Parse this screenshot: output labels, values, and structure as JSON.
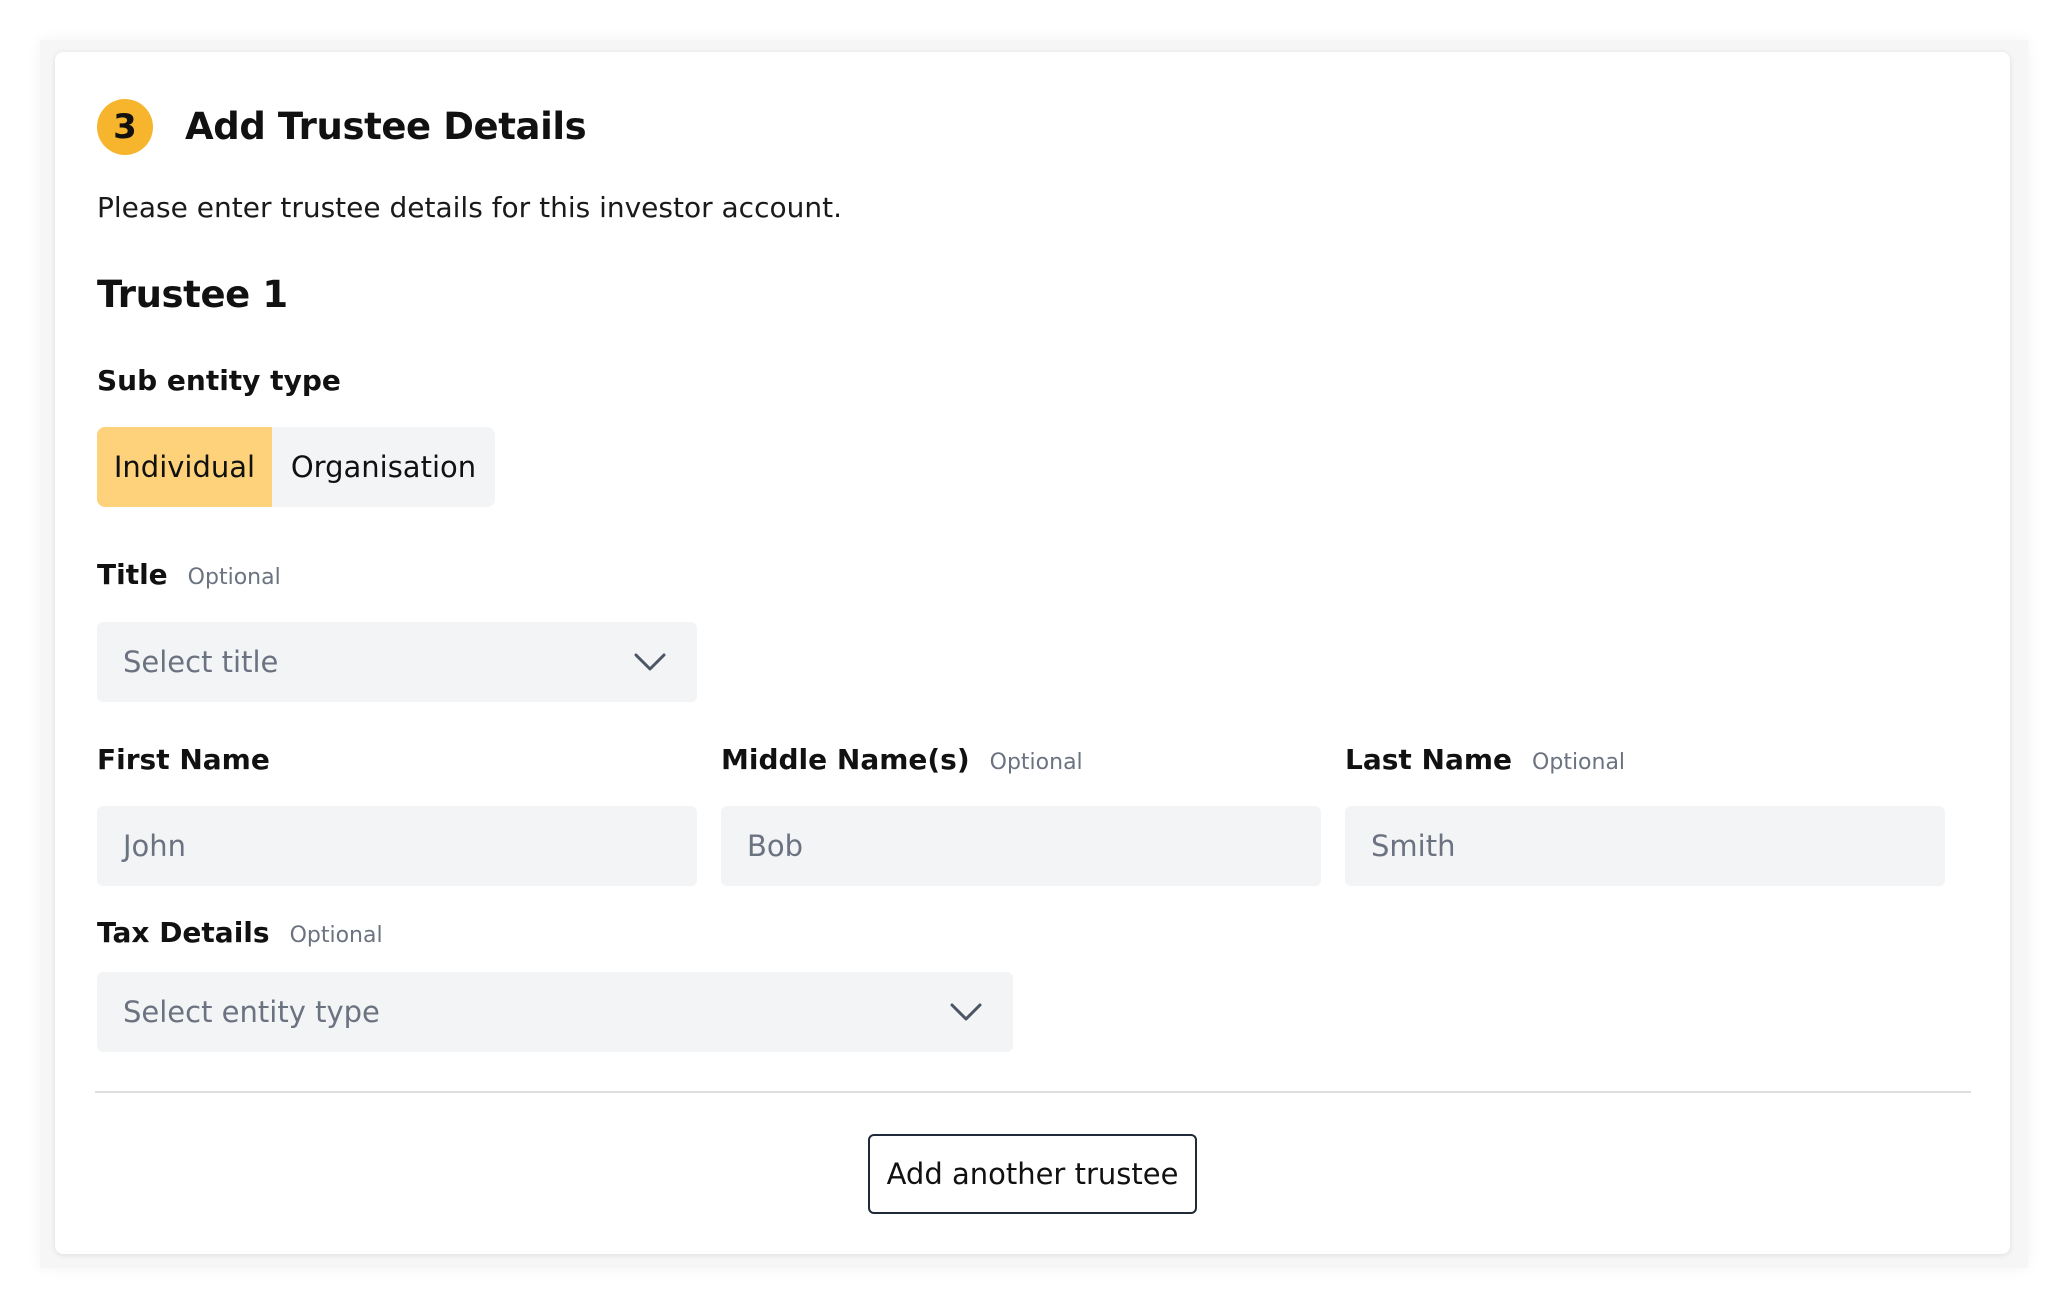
{
  "section": {
    "step_number": "3",
    "title": "Add Trustee Details",
    "description": "Please enter trustee details for this investor account."
  },
  "trustee": {
    "heading": "Trustee 1",
    "sub_entity_type": {
      "label": "Sub entity type",
      "options": [
        "Individual",
        "Organisation"
      ],
      "selected": "Individual"
    },
    "title_field": {
      "label": "Title",
      "optional": "Optional",
      "placeholder": "Select title"
    },
    "first_name": {
      "label": "First Name",
      "placeholder": "John"
    },
    "middle_name": {
      "label": "Middle Name(s)",
      "optional": "Optional",
      "placeholder": "Bob"
    },
    "last_name": {
      "label": "Last Name",
      "optional": "Optional",
      "placeholder": "Smith"
    },
    "tax_details": {
      "label": "Tax Details",
      "optional": "Optional",
      "placeholder": "Select entity type"
    }
  },
  "actions": {
    "add_trustee_label": "Add another trustee"
  },
  "colors": {
    "accent": "#f7b52e",
    "selected_segment": "#fdd27b",
    "field_bg": "#f3f4f6",
    "placeholder_text": "#6b7280"
  },
  "icons": {
    "select_chevron": "chevron-down-icon"
  }
}
